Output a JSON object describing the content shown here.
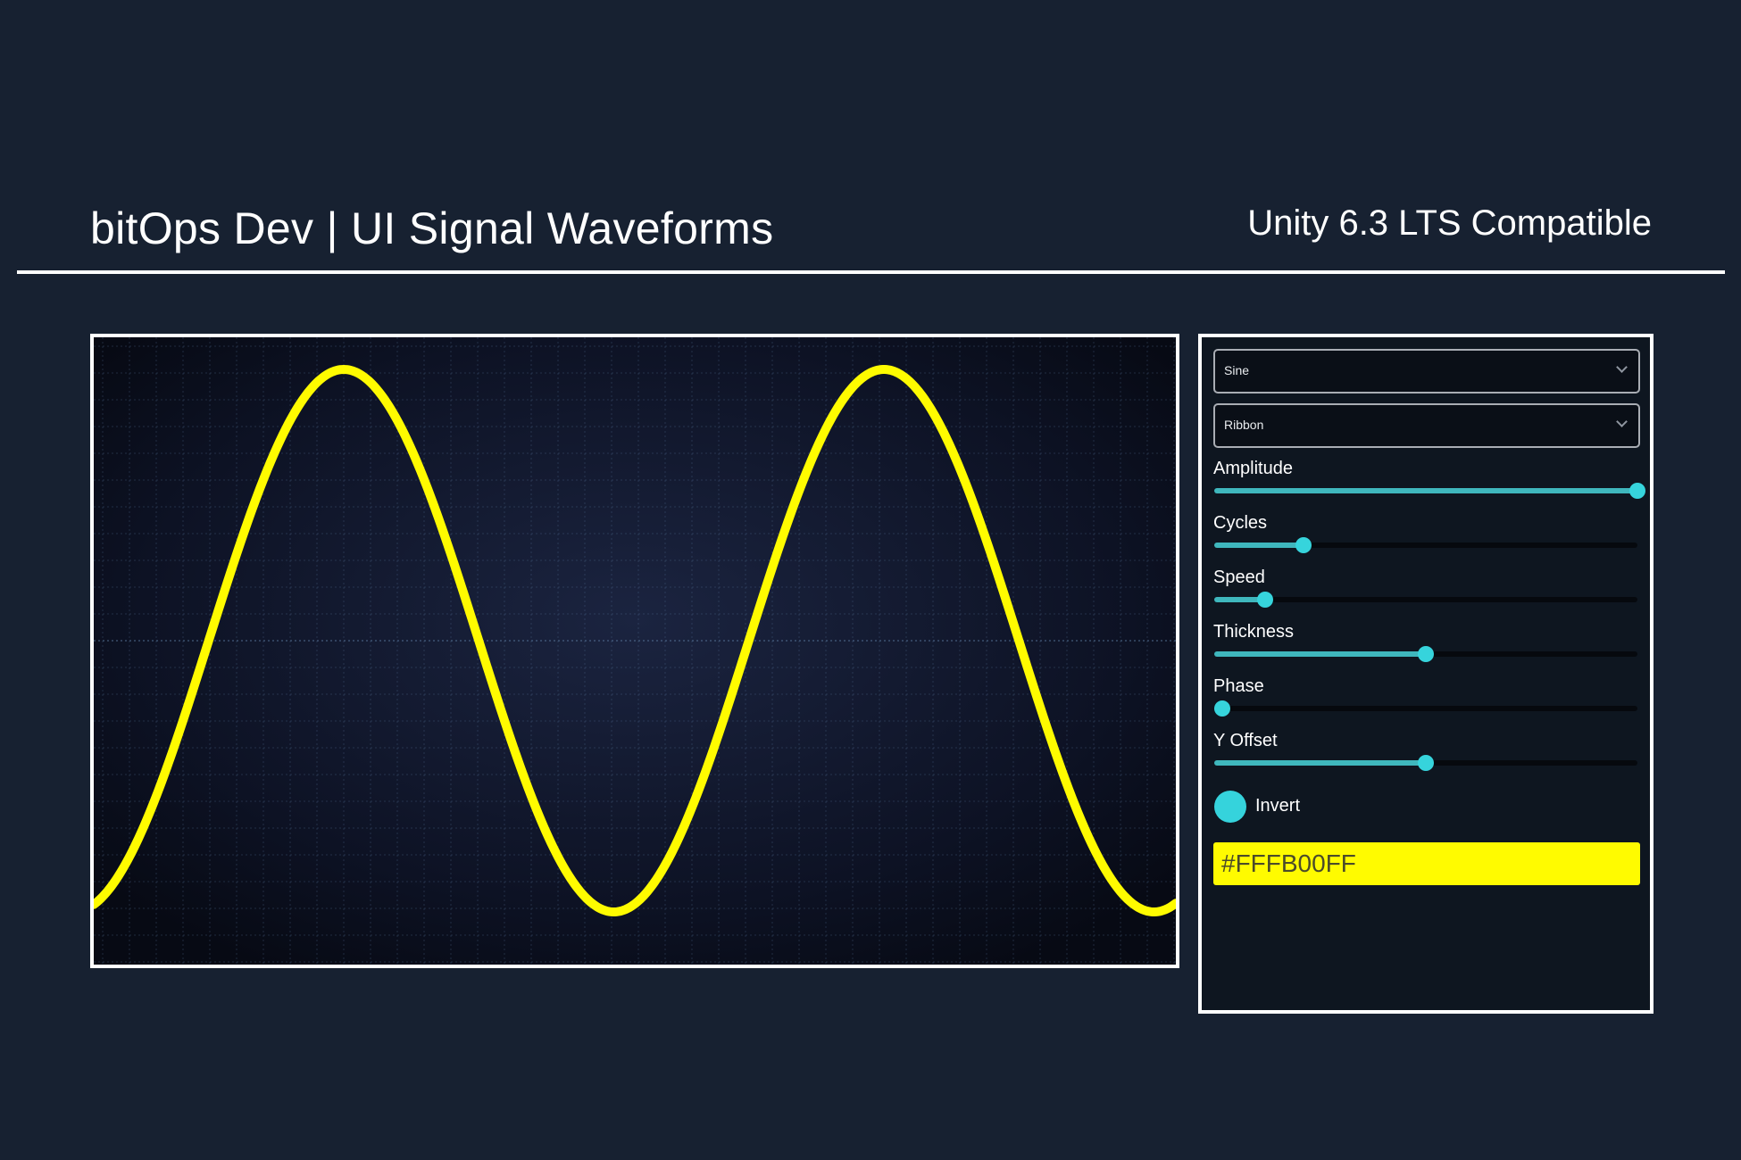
{
  "header": {
    "title": "bitOps Dev | UI Signal Waveforms",
    "subtitle": "Unity 6.3 LTS Compatible"
  },
  "waveform": {
    "type": "sine",
    "cycles": 2,
    "color": "#FFFB00",
    "background": "#0b0f1c",
    "grid_color": "#5e7fa6"
  },
  "panel": {
    "wave_dropdown": {
      "value": "Sine"
    },
    "style_dropdown": {
      "value": "Ribbon"
    },
    "sliders": [
      {
        "label": "Amplitude",
        "value": 1.0
      },
      {
        "label": "Cycles",
        "value": 0.21
      },
      {
        "label": "Speed",
        "value": 0.12
      },
      {
        "label": "Thickness",
        "value": 0.5
      },
      {
        "label": "Phase",
        "value": 0.02
      },
      {
        "label": "Y Offset",
        "value": 0.5
      }
    ],
    "invert": {
      "label": "Invert"
    },
    "color_field": {
      "value": "#FFFB00FF"
    }
  },
  "colors": {
    "accent": "#36d4dc",
    "slider_fill": "#3fb7bd",
    "background": "#172131"
  }
}
